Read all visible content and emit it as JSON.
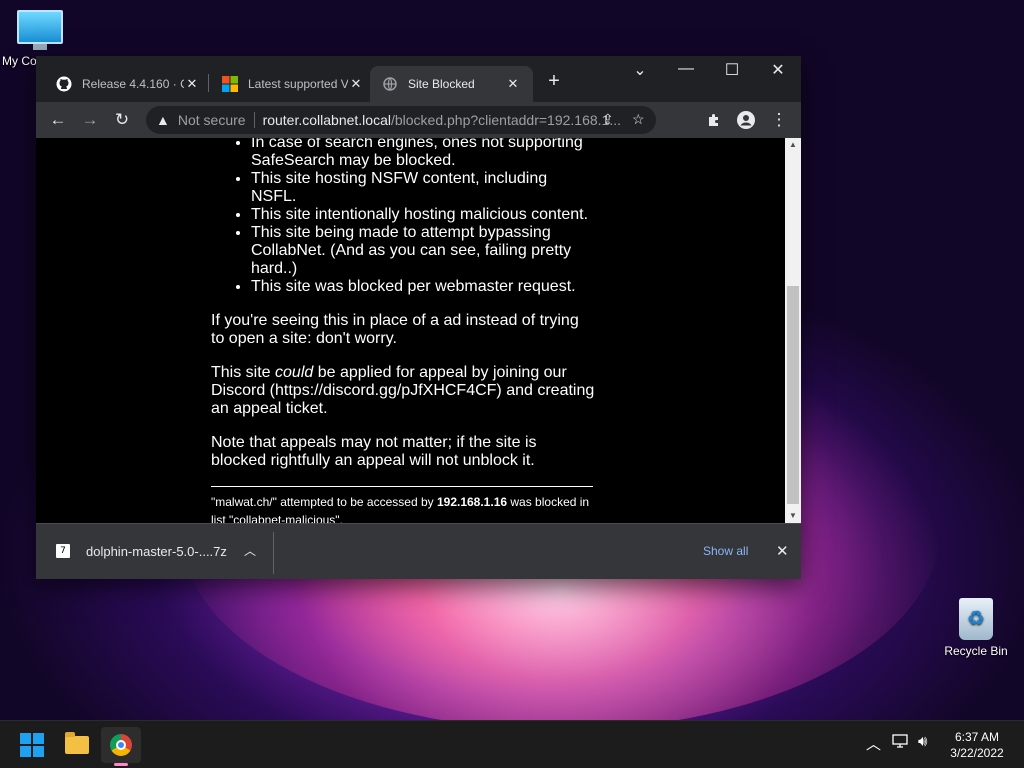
{
  "desktop": {
    "icons": [
      {
        "label": "My Co"
      },
      {
        "label": "Recycle Bin"
      }
    ]
  },
  "browser": {
    "tabs": [
      {
        "title": "Release 4.4.160 · C",
        "icon": "github-icon",
        "active": false
      },
      {
        "title": "Latest supported V",
        "icon": "microsoft-icon",
        "active": false
      },
      {
        "title": "Site Blocked",
        "icon": "globe-icon",
        "active": true
      }
    ],
    "window_controls": {
      "tab_search": "⌄",
      "minimize": "—",
      "maximize": "☐",
      "close": "✕"
    },
    "address_bar": {
      "security_label": "Not secure",
      "host": "router.collabnet.local",
      "path": "/blocked.php?clientaddr=192.168.1..."
    },
    "download": {
      "file_name": "dolphin-master-5.0-....7z",
      "show_all": "Show all"
    }
  },
  "page": {
    "bullets": [
      "In case of search engines, ones not supporting SafeSearch may be blocked.",
      "This site hosting NSFW content, including NSFL.",
      "This site intentionally hosting malicious content.",
      "This site being made to attempt bypassing CollabNet. (And as you can see, failing pretty hard..)",
      "This site was blocked per webmaster request."
    ],
    "para_ad": "If you're seeing this in place of a ad instead of trying to open a site: don't worry.",
    "para_appeal": {
      "before": "This site ",
      "emph": "could",
      "after": " be applied for appeal by joining our Discord (https://discord.gg/pJfXHCF4CF) and creating an appeal ticket."
    },
    "para_note": "Note that appeals may not matter; if the site is blocked rightfully an appeal will not unblock it.",
    "footer": {
      "site": "\"malwat.ch/\" attempted to be accessed by ",
      "ip": "192.168.1.16",
      "tail": " was blocked in list \"collabnet-malicious\"."
    }
  },
  "taskbar": {
    "clock_time": "6:37 AM",
    "clock_date": "3/22/2022"
  }
}
